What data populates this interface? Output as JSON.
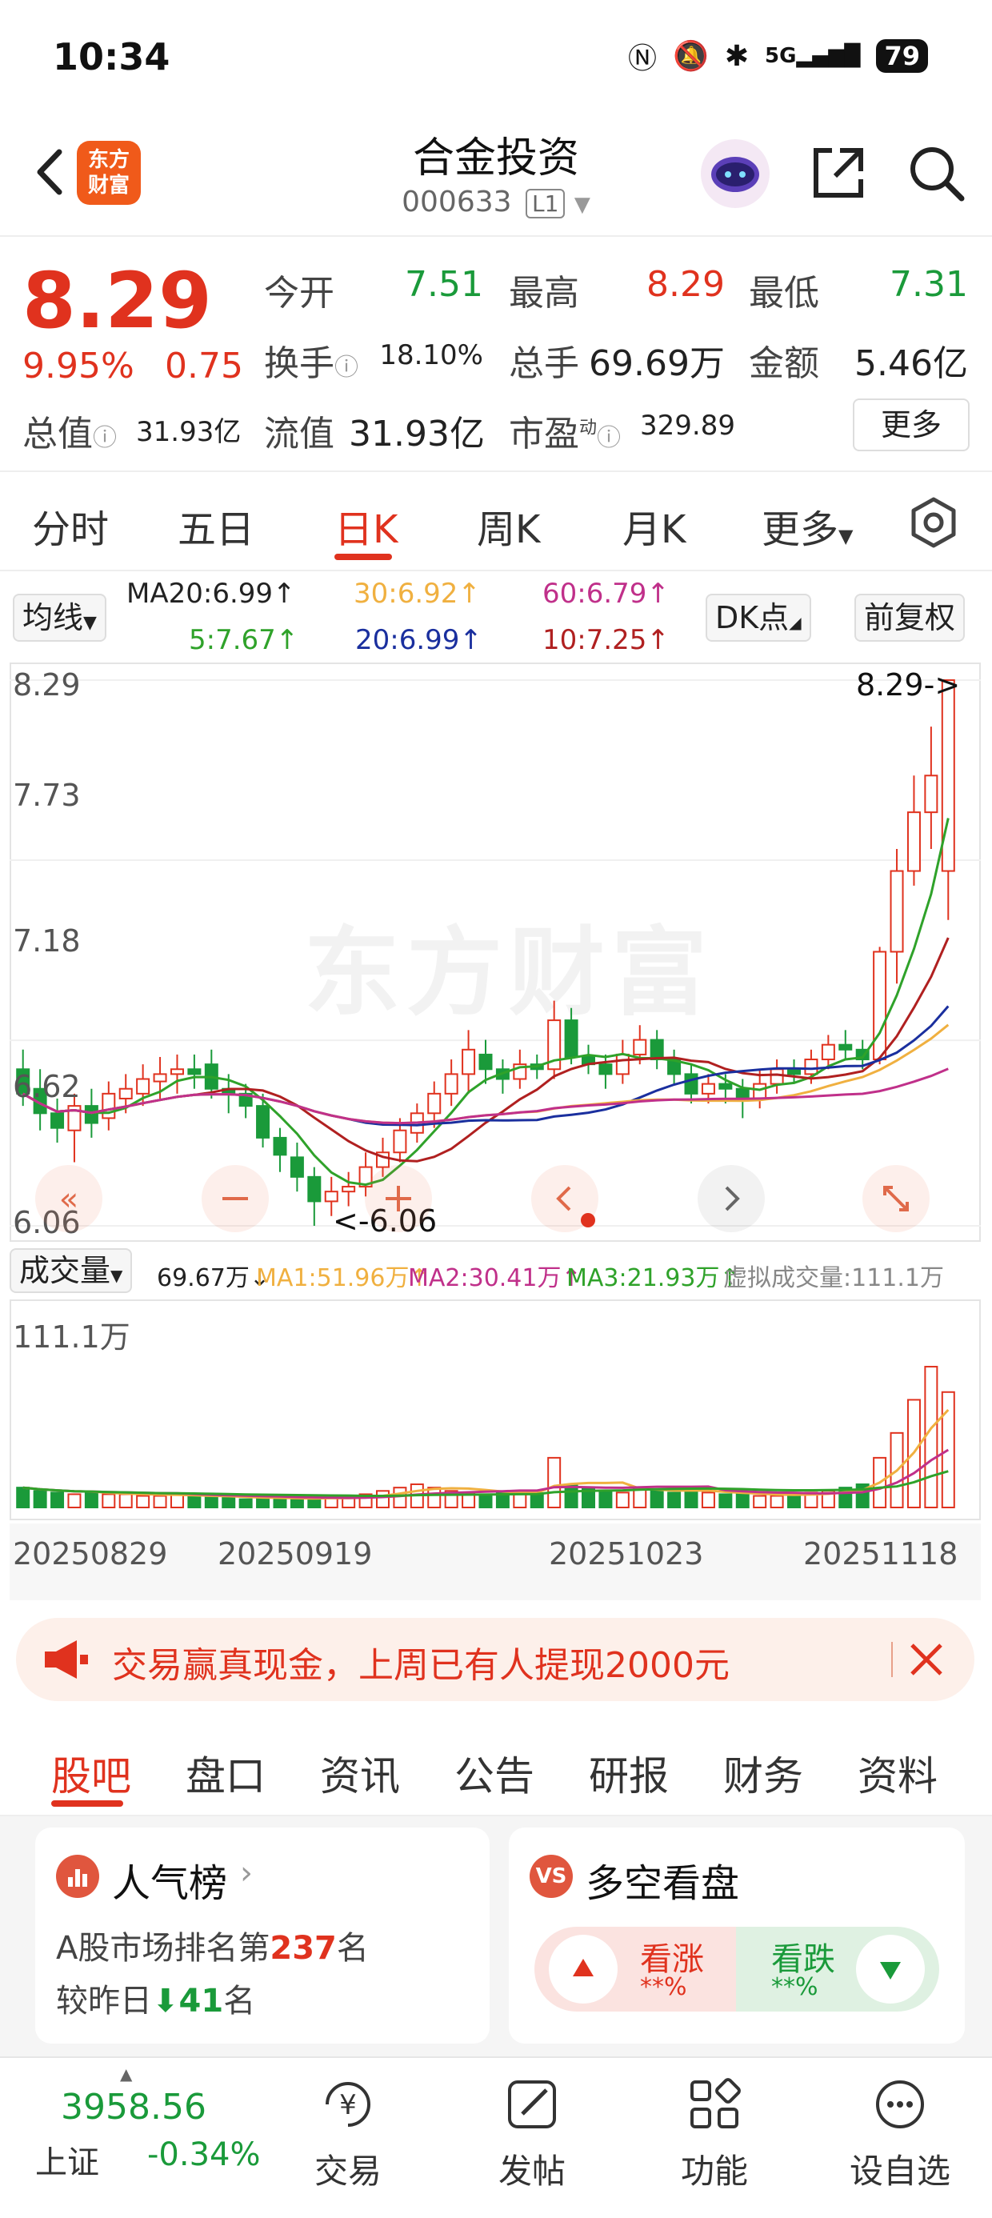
{
  "status": {
    "time": "10:34",
    "battery": "79",
    "signal": "5G"
  },
  "header": {
    "logo_text": "东方\n财富",
    "stock_name": "合金投资",
    "stock_code": "000633",
    "level_badge": "L1"
  },
  "quote": {
    "price": "8.29",
    "change_pct": "9.95%",
    "change": "0.75",
    "open_label": "今开",
    "open": "7.51",
    "high_label": "最高",
    "high": "8.29",
    "low_label": "最低",
    "low": "7.31",
    "turnover_label": "换手",
    "turnover": "18.10%",
    "volume_label": "总手",
    "volume": "69.69万",
    "amount_label": "金额",
    "amount": "5.46亿",
    "mktcap_label": "总值",
    "mktcap": "31.93亿",
    "float_label": "流值",
    "float_cap": "31.93亿",
    "pe_label": "市盈",
    "pe_sup": "动",
    "pe": "329.89",
    "more_label": "更多"
  },
  "period_tabs": [
    "分时",
    "五日",
    "日K",
    "周K",
    "月K",
    "更多"
  ],
  "active_period": "日K",
  "ma_row": {
    "ma_chip": "均线",
    "ma20_main": "MA20:6.99↑",
    "ma30": "30:6.92↑",
    "ma60": "60:6.79↑",
    "ma5": "5:7.67↑",
    "ma20": "20:6.99↑",
    "ma10": "10:7.25↑",
    "dk_chip": "DK点",
    "adjust_chip": "前复权"
  },
  "kchart_axis": {
    "top": "8.29",
    "mid1": "7.73",
    "mid2": "7.18",
    "mid3": "6.62",
    "bottom": "6.06",
    "high_marker": "8.29->",
    "low_marker": "<-6.06"
  },
  "watermark": "东方财富",
  "volume_row": {
    "chip": "成交量",
    "vol": "69.67万↓",
    "ma1": "MA1:51.96万↑",
    "ma2": "MA2:30.41万↑",
    "ma3": "MA3:21.93万↑",
    "virtual": "虚拟成交量:111.1万",
    "axis_top": "111.1万"
  },
  "dates": [
    "20250829",
    "20250919",
    "20251023",
    "20251118"
  ],
  "banner": {
    "text": "交易赢真现金，上周已有人提现2000元"
  },
  "content_tabs": [
    "股吧",
    "盘口",
    "资讯",
    "公告",
    "研报",
    "财务",
    "资料"
  ],
  "active_content_tab": "股吧",
  "popularity": {
    "title": "人气榜",
    "line1_prefix": "A股市场排名第",
    "rank": "237",
    "line1_suffix": "名",
    "line2_prefix": "较昨日",
    "delta": "41",
    "line2_suffix": "名"
  },
  "sentiment": {
    "title": "多空看盘",
    "bull_label": "看涨",
    "bull_value": "**%",
    "bear_label": "看跌",
    "bear_value": "**%"
  },
  "bottom_nav": {
    "index_value": "3958.56",
    "index_name": "上证",
    "index_change": "-0.34%",
    "items": [
      "交易",
      "发帖",
      "功能",
      "设自选"
    ]
  },
  "colors": {
    "up": "#e0321e",
    "down": "#1a9a3a",
    "ma5": "#2fa22a",
    "ma10": "#b02020",
    "ma20": "#1a2f9e",
    "ma30": "#f0b040",
    "ma60": "#c0308a"
  },
  "chart_data": {
    "type": "candlestick",
    "dates": [
      "20250829",
      "20250919",
      "20251023",
      "20251118"
    ],
    "y_axis_labels": [
      "8.29",
      "7.73",
      "7.18",
      "6.62",
      "6.06"
    ],
    "price_range": [
      6.06,
      8.29
    ],
    "candles": [
      [
        6.7,
        6.6,
        6.55,
        6.78
      ],
      [
        6.62,
        6.52,
        6.45,
        6.7
      ],
      [
        6.52,
        6.46,
        6.4,
        6.58
      ],
      [
        6.45,
        6.55,
        6.32,
        6.6
      ],
      [
        6.55,
        6.48,
        6.42,
        6.62
      ],
      [
        6.5,
        6.6,
        6.45,
        6.65
      ],
      [
        6.58,
        6.62,
        6.52,
        6.68
      ],
      [
        6.6,
        6.66,
        6.55,
        6.72
      ],
      [
        6.65,
        6.68,
        6.58,
        6.75
      ],
      [
        6.68,
        6.7,
        6.6,
        6.76
      ],
      [
        6.7,
        6.68,
        6.62,
        6.76
      ],
      [
        6.72,
        6.62,
        6.58,
        6.78
      ],
      [
        6.62,
        6.6,
        6.52,
        6.68
      ],
      [
        6.6,
        6.55,
        6.5,
        6.64
      ],
      [
        6.55,
        6.42,
        6.38,
        6.6
      ],
      [
        6.42,
        6.35,
        6.28,
        6.46
      ],
      [
        6.34,
        6.26,
        6.2,
        6.4
      ],
      [
        6.26,
        6.16,
        6.06,
        6.3
      ],
      [
        6.16,
        6.2,
        6.1,
        6.26
      ],
      [
        6.2,
        6.22,
        6.14,
        6.28
      ],
      [
        6.22,
        6.3,
        6.18,
        6.36
      ],
      [
        6.3,
        6.36,
        6.26,
        6.42
      ],
      [
        6.36,
        6.45,
        6.32,
        6.5
      ],
      [
        6.44,
        6.52,
        6.4,
        6.56
      ],
      [
        6.52,
        6.6,
        6.46,
        6.65
      ],
      [
        6.6,
        6.68,
        6.55,
        6.74
      ],
      [
        6.68,
        6.78,
        6.6,
        6.86
      ],
      [
        6.76,
        6.7,
        6.64,
        6.82
      ],
      [
        6.7,
        6.66,
        6.6,
        6.74
      ],
      [
        6.66,
        6.72,
        6.62,
        6.78
      ],
      [
        6.72,
        6.7,
        6.66,
        6.76
      ],
      [
        6.7,
        6.9,
        6.66,
        6.98
      ],
      [
        6.9,
        6.75,
        6.72,
        6.95
      ],
      [
        6.75,
        6.72,
        6.68,
        6.8
      ],
      [
        6.72,
        6.68,
        6.62,
        6.76
      ],
      [
        6.68,
        6.76,
        6.64,
        6.82
      ],
      [
        6.76,
        6.82,
        6.72,
        6.88
      ],
      [
        6.82,
        6.74,
        6.7,
        6.86
      ],
      [
        6.74,
        6.68,
        6.64,
        6.78
      ],
      [
        6.68,
        6.6,
        6.56,
        6.72
      ],
      [
        6.6,
        6.64,
        6.56,
        6.68
      ],
      [
        6.64,
        6.62,
        6.56,
        6.68
      ],
      [
        6.62,
        6.58,
        6.5,
        6.66
      ],
      [
        6.58,
        6.64,
        6.54,
        6.7
      ],
      [
        6.64,
        6.7,
        6.6,
        6.74
      ],
      [
        6.7,
        6.68,
        6.64,
        6.74
      ],
      [
        6.68,
        6.74,
        6.64,
        6.78
      ],
      [
        6.74,
        6.8,
        6.7,
        6.84
      ],
      [
        6.8,
        6.78,
        6.74,
        6.86
      ],
      [
        6.78,
        6.74,
        6.7,
        6.82
      ],
      [
        6.74,
        7.18,
        6.72,
        7.2
      ],
      [
        7.18,
        7.51,
        7.05,
        7.6
      ],
      [
        7.51,
        7.75,
        7.45,
        7.9
      ],
      [
        7.75,
        7.9,
        7.6,
        8.1
      ],
      [
        7.51,
        8.29,
        7.31,
        8.29
      ]
    ],
    "volume_range": [
      0,
      111.1
    ],
    "volumes": [
      12,
      10,
      9,
      8,
      9,
      8,
      8,
      7,
      7,
      8,
      7,
      6,
      6,
      5,
      6,
      6,
      5,
      5,
      6,
      6,
      8,
      10,
      12,
      14,
      12,
      10,
      9,
      8,
      9,
      10,
      8,
      30,
      14,
      12,
      10,
      9,
      12,
      11,
      9,
      10,
      9,
      8,
      8,
      7,
      7,
      8,
      9,
      10,
      12,
      14,
      30,
      45,
      65,
      85,
      69.67
    ],
    "ma_series": {
      "MA5": 7.67,
      "MA10": 7.25,
      "MA20": 6.99,
      "MA30": 6.92,
      "MA60": 6.79
    },
    "volume_ma": {
      "MA1": 51.96,
      "MA2": 30.41,
      "MA3": 21.93
    }
  }
}
